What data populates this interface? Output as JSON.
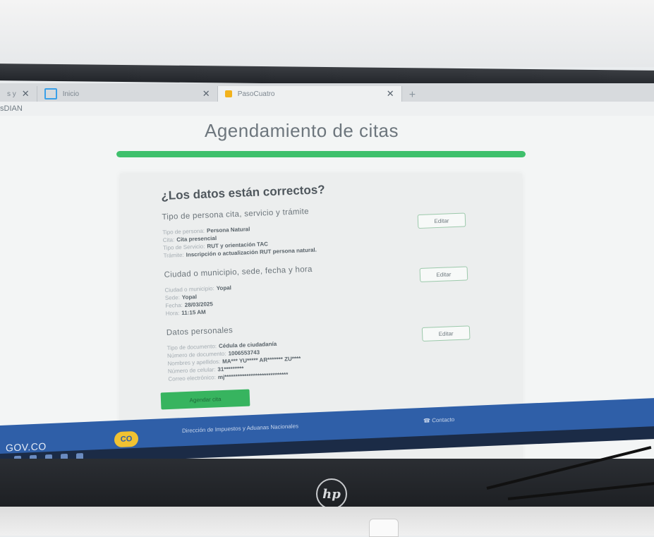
{
  "browser": {
    "tabs": [
      {
        "label": "s y",
        "active": false
      },
      {
        "label": "Inicio",
        "active": false
      },
      {
        "label": "PasoCuatro",
        "active": true
      }
    ],
    "url_text": "sDIAN"
  },
  "page": {
    "title": "Agendamiento de citas",
    "progress_percent": 100,
    "question": "¿Los datos están correctos?",
    "sections": [
      {
        "title": "Tipo de persona cita, servicio y trámite",
        "rows": [
          {
            "label": "Tipo de persona:",
            "value": "Persona Natural"
          },
          {
            "label": "Cita:",
            "value": "Cita presencial"
          },
          {
            "label": "Tipo de Servicio:",
            "value": "RUT y orientación TAC"
          },
          {
            "label": "Trámite:",
            "value": "Inscripción o actualización RUT persona natural."
          }
        ],
        "edit_label": "Editar"
      },
      {
        "title": "Ciudad o municipio, sede, fecha y hora",
        "rows": [
          {
            "label": "Ciudad o municipio:",
            "value": "Yopal"
          },
          {
            "label": "Sede:",
            "value": "Yopal"
          },
          {
            "label": "Fecha:",
            "value": "28/03/2025"
          },
          {
            "label": "Hora:",
            "value": "11:15 AM"
          }
        ],
        "edit_label": "Editar"
      },
      {
        "title": "Datos personales",
        "rows": [
          {
            "label": "Tipo de documento:",
            "value": "Cédula de ciudadanía"
          },
          {
            "label": "Número de documento:",
            "value": "1006553743"
          },
          {
            "label": "Nombres y apellidos:",
            "value": "MA*** YU***** AR******* ZU****"
          },
          {
            "label": "Número de celular:",
            "value": "31*********"
          },
          {
            "label": "Correo electrónico:",
            "value": "mj*****************************"
          }
        ],
        "edit_label": "Editar"
      }
    ],
    "submit_label": "Agendar cita"
  },
  "footer": {
    "gov_label": "GOV.CO",
    "co_badge": "CO",
    "entity": "Dirección de Impuestos y Aduanas Nacionales",
    "contact": "Contacto"
  },
  "monitor": {
    "brand": "hp"
  }
}
